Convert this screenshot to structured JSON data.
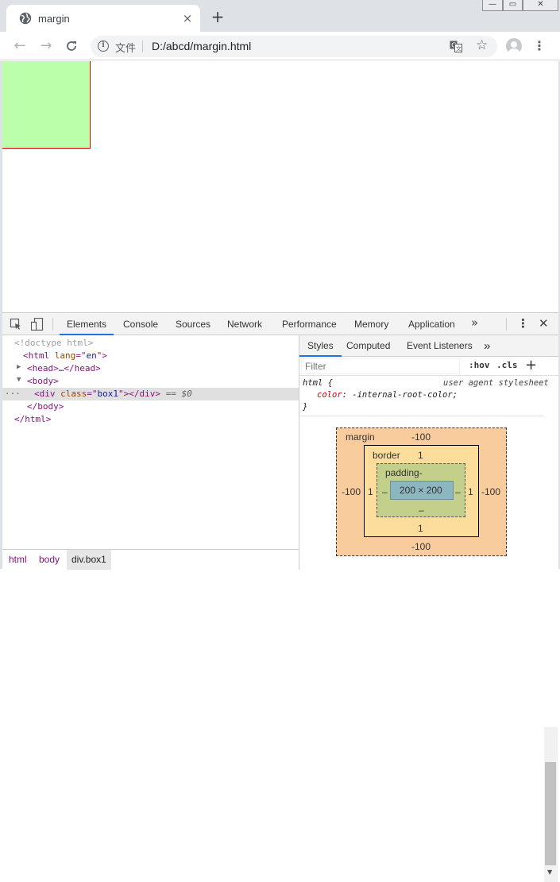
{
  "browser": {
    "tab_title": "margin",
    "tab_close": "×",
    "new_tab": "+",
    "window_buttons": [
      "—",
      "▭",
      "✕"
    ],
    "url_scheme_label": "文件",
    "url": "D:/abcd/margin.html"
  },
  "page": {
    "box_color": "#bbffaa",
    "box_border_color": "#cc0000"
  },
  "devtools": {
    "tabs": [
      "Elements",
      "Console",
      "Sources",
      "Network",
      "Performance",
      "Memory",
      "Application"
    ],
    "active_tab": "Elements",
    "more": "»",
    "dom": {
      "doctype": "<!doctype html>",
      "html_tag": "html",
      "html_attr": "lang",
      "html_attr_value": "en",
      "head_tag": "head",
      "ellipsis": "…",
      "body_tag": "body",
      "div_tag": "div",
      "div_attr": "class",
      "div_attr_value": "box1",
      "selected_marker": "== $0",
      "dots": "..."
    },
    "breadcrumbs": [
      "html",
      "body",
      "div.box1"
    ],
    "styles": {
      "tabs": [
        "Styles",
        "Computed",
        "Event Listeners"
      ],
      "filter_placeholder": "Filter",
      "hov": ":hov",
      "cls": ".cls",
      "add": "+",
      "rule_selector": "html {",
      "rule_source": "user agent stylesheet",
      "rule_property": "color",
      "rule_value": "-internal-root-color;",
      "rule_close": "}"
    },
    "box_model": {
      "margin_label": "margin",
      "margin_top": "-100",
      "margin_left": "-100",
      "margin_right": "-100",
      "margin_bottom": "-100",
      "border_label": "border",
      "border_top": "1",
      "border_left": "1",
      "border_right": "1",
      "border_bottom": "1",
      "padding_label": "padding-",
      "padding_left": "–",
      "padding_right": "–",
      "padding_bottom": "–",
      "content": "200 × 200",
      "colors": {
        "margin": "#f9cc9d",
        "border": "#fddd9b",
        "padding": "#c3d08b",
        "content": "#8cb6c0"
      }
    }
  }
}
